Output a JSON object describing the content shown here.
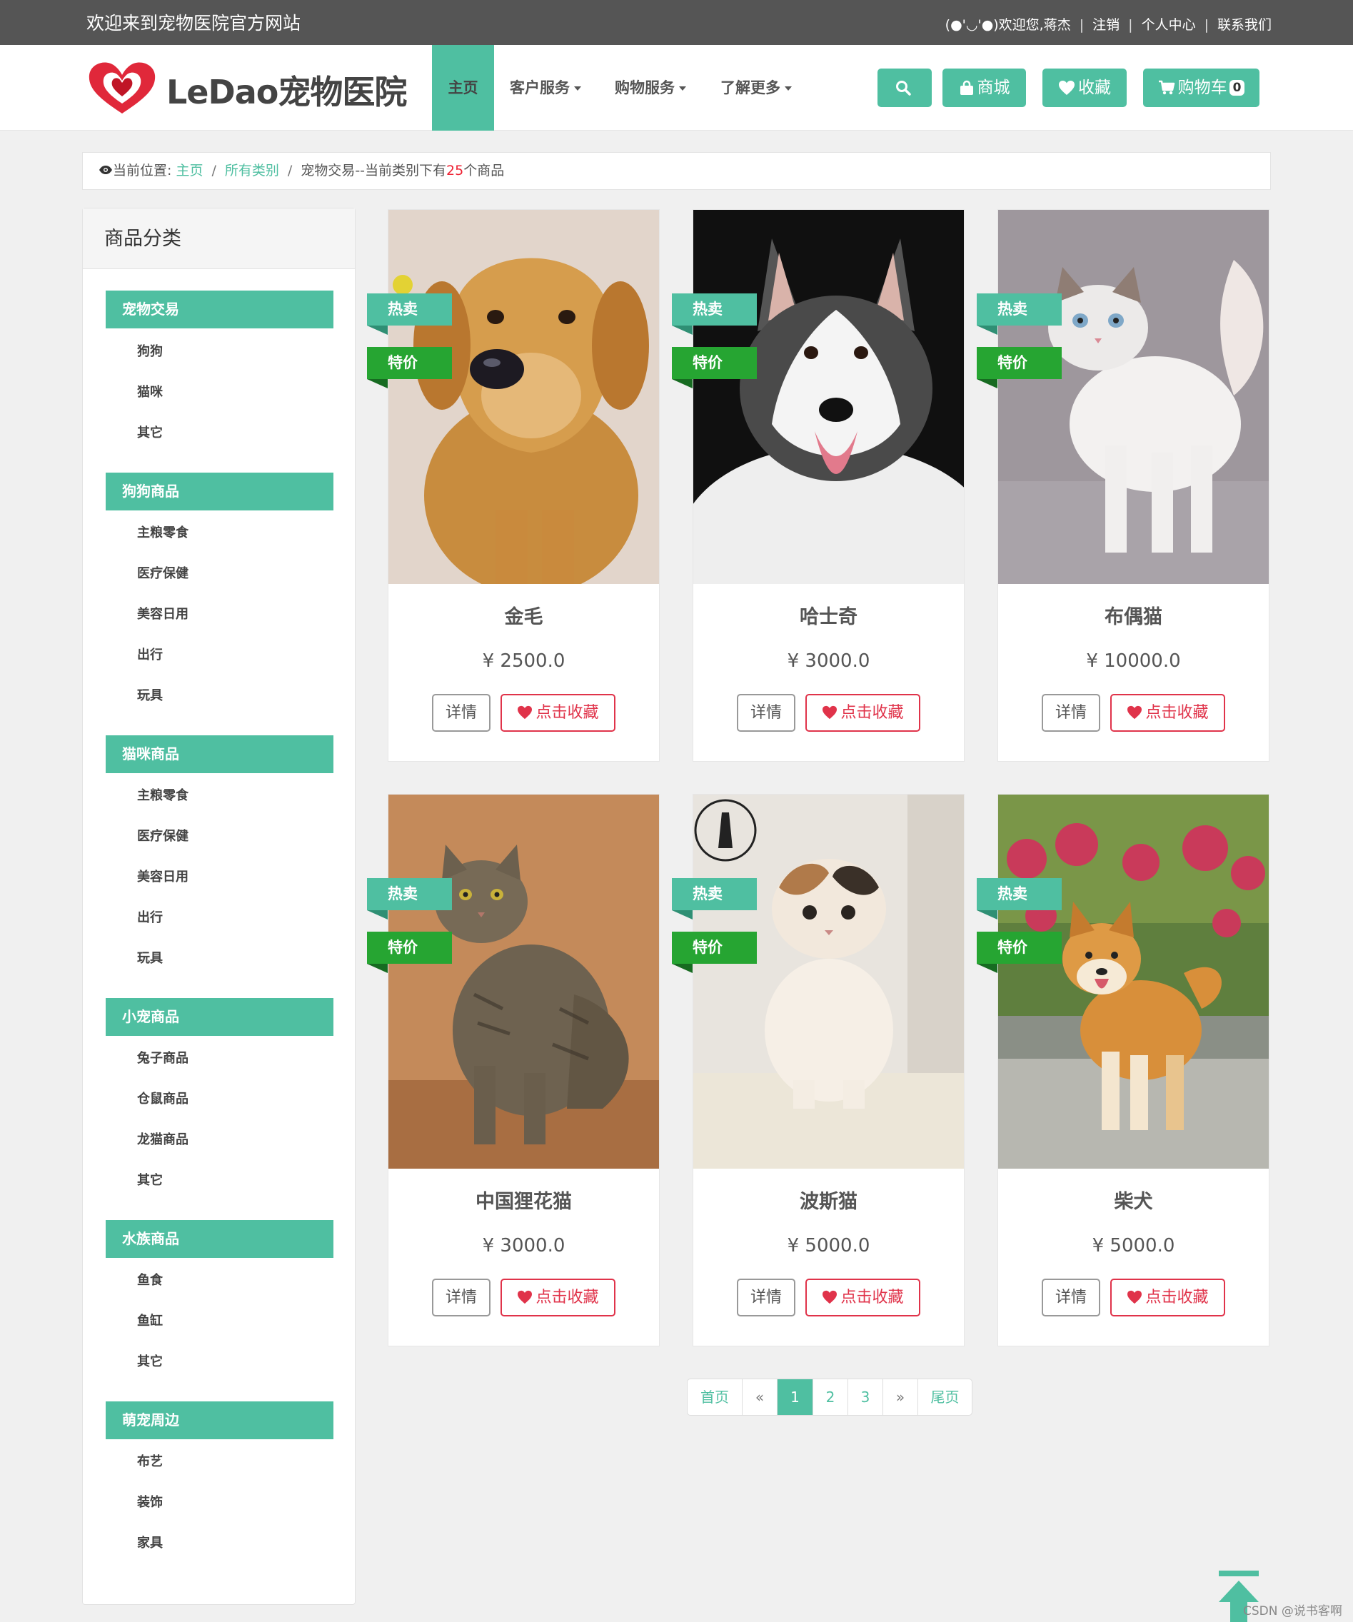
{
  "topbar": {
    "welcome": "欢迎来到宠物医院官方网站",
    "greeting": "(●'◡'●)欢迎您,蒋杰",
    "logout": "注销",
    "user_center": "个人中心",
    "contact": "联系我们",
    "separator": "|"
  },
  "header": {
    "logo_text": "LeDao宠物医院",
    "nav": [
      "主页",
      "客户服务",
      "购物服务",
      "了解更多"
    ],
    "buttons": {
      "mall": "商城",
      "favorites": "收藏",
      "cart": "购物车",
      "cart_count": "0"
    },
    "brand_color": "#4fbfa1"
  },
  "breadcrumb": {
    "prefix": "当前位置:",
    "home": "主页",
    "all": "所有类别",
    "current": "宠物交易",
    "info_pre": "--当前类别下有",
    "count": "25",
    "info_post": "个商品"
  },
  "sidebar": {
    "title": "商品分类",
    "categories": [
      {
        "name": "宠物交易",
        "items": [
          "狗狗",
          "猫咪",
          "其它"
        ]
      },
      {
        "name": "狗狗商品",
        "items": [
          "主粮零食",
          "医疗保健",
          "美容日用",
          "出行",
          "玩具"
        ]
      },
      {
        "name": "猫咪商品",
        "items": [
          "主粮零食",
          "医疗保健",
          "美容日用",
          "出行",
          "玩具"
        ]
      },
      {
        "name": "小宠商品",
        "items": [
          "兔子商品",
          "仓鼠商品",
          "龙猫商品",
          "其它"
        ]
      },
      {
        "name": "水族商品",
        "items": [
          "鱼食",
          "鱼缸",
          "其它"
        ]
      },
      {
        "name": "萌宠周边",
        "items": [
          "布艺",
          "装饰",
          "家具"
        ]
      }
    ]
  },
  "products": [
    {
      "name": "金毛",
      "price": "¥ 2500.0",
      "image": "golden-retriever"
    },
    {
      "name": "哈士奇",
      "price": "¥ 3000.0",
      "image": "husky"
    },
    {
      "name": "布偶猫",
      "price": "¥ 10000.0",
      "image": "ragdoll-cat"
    },
    {
      "name": "中国狸花猫",
      "price": "¥ 3000.0",
      "image": "tabby-cat"
    },
    {
      "name": "波斯猫",
      "price": "¥ 5000.0",
      "image": "persian-kitten"
    },
    {
      "name": "柴犬",
      "price": "¥ 5000.0",
      "image": "shiba-inu"
    }
  ],
  "labels": {
    "hot": "热卖",
    "sale": "特价",
    "detail": "详情",
    "favorite": "点击收藏"
  },
  "pagination": {
    "first": "首页",
    "prev": "«",
    "pages": [
      "1",
      "2",
      "3"
    ],
    "current": "1",
    "next": "»",
    "last": "尾页"
  },
  "footer_watermark": "CSDN @说书客啊"
}
